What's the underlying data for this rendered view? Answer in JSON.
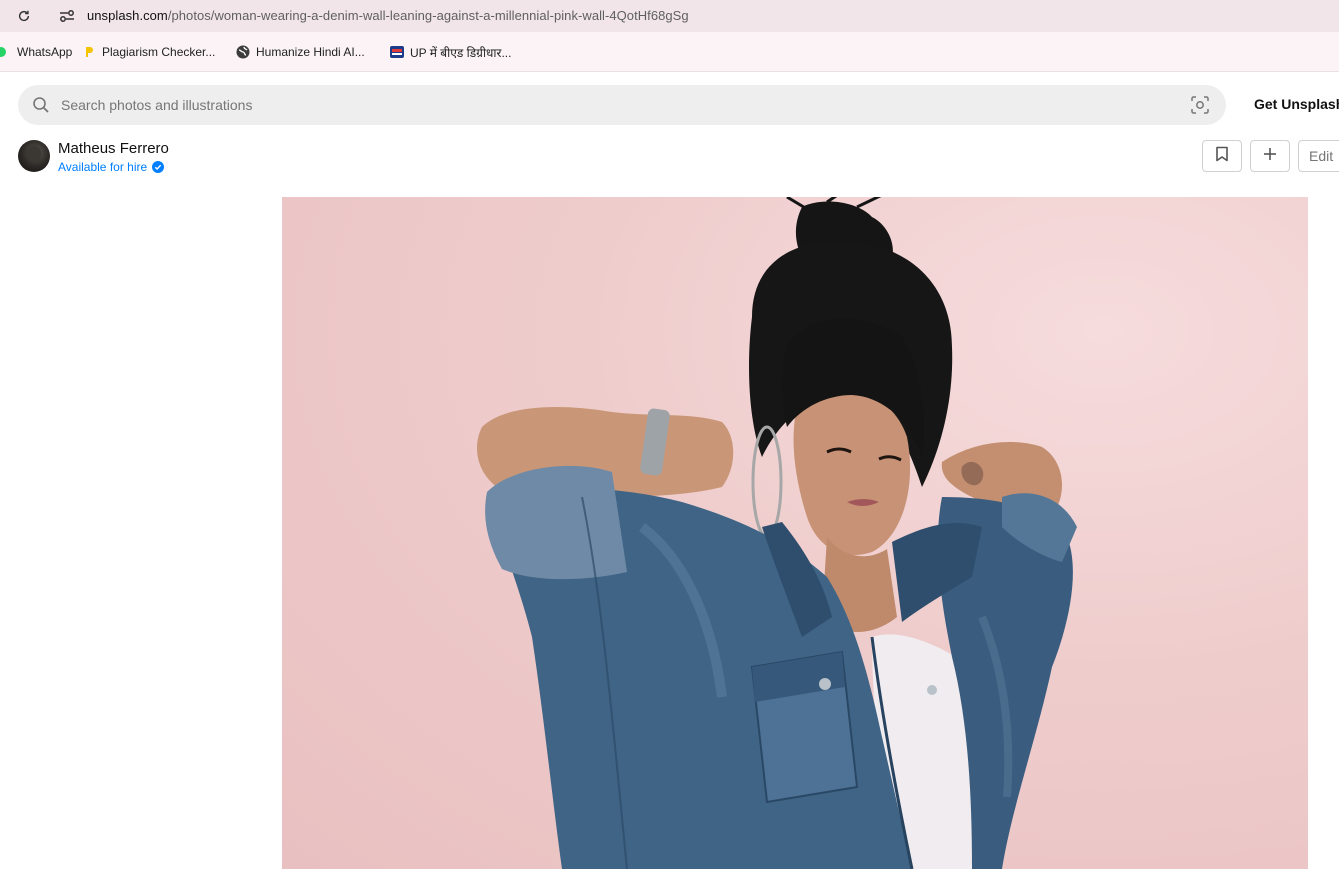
{
  "browser": {
    "url_host": "unsplash.com",
    "url_path": "/photos/woman-wearing-a-denim-wall-leaning-against-a-millennial-pink-wall-4QotHf68gSg",
    "reload_icon": "reload-icon",
    "site_info_icon": "site-settings-icon"
  },
  "bookmarks": [
    {
      "label": "WhatsApp",
      "icon": "whatsapp-icon"
    },
    {
      "label": "Plagiarism Checker...",
      "icon": "plagiarism-checker-icon"
    },
    {
      "label": "Humanize Hindi AI...",
      "icon": "globe-icon"
    },
    {
      "label": "UP में बीएड डिग्रीधार...",
      "icon": "news-icon"
    }
  ],
  "header": {
    "search_placeholder": "Search photos and illustrations",
    "get_unsplash": "Get Unsplash"
  },
  "author": {
    "name": "Matheus Ferrero",
    "status": "Available for hire"
  },
  "actions": {
    "edit_label": "Edit"
  },
  "colors": {
    "accent_blue": "#007fff",
    "wall_pink": "#efcccc",
    "denim": "#3d5f7f"
  }
}
